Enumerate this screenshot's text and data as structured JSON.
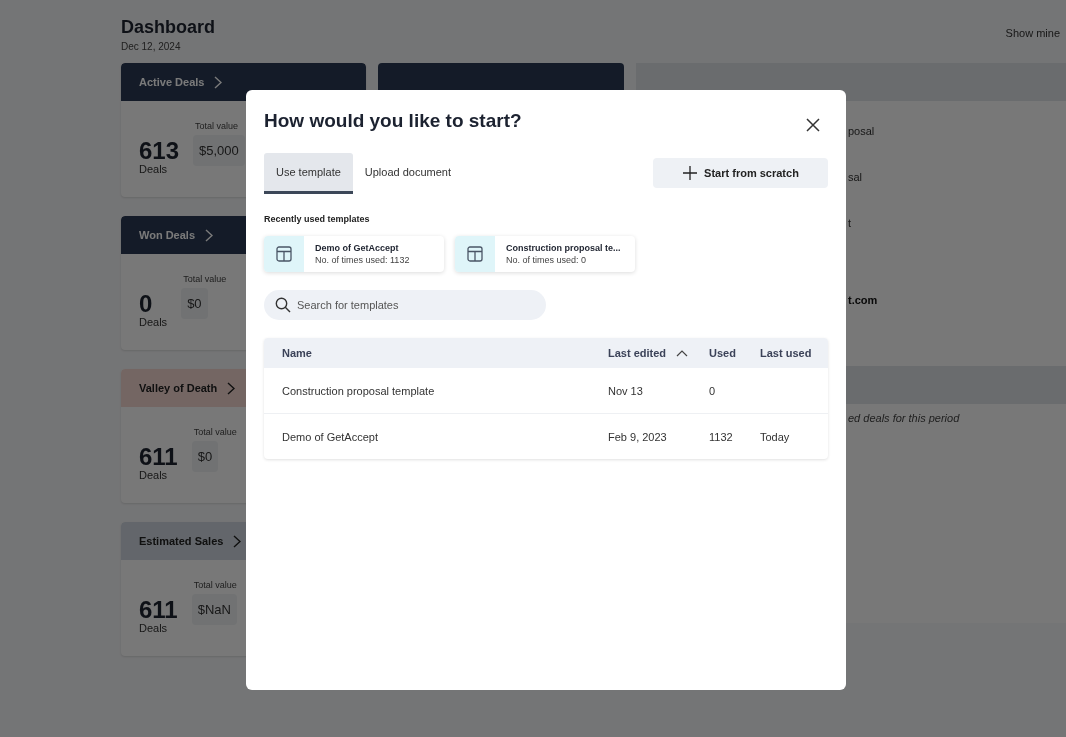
{
  "page": {
    "title": "Dashboard",
    "date": "Dec 12, 2024",
    "show_mine": "Show mine"
  },
  "deal_cards": [
    {
      "title": "Active Deals",
      "kind": "dark",
      "count": "613",
      "count_label": "Deals",
      "total_label": "Total value",
      "total": "$5,000"
    },
    {
      "title": "Won Deals",
      "kind": "dark",
      "count": "0",
      "count_label": "Deals",
      "total_label": "Total value",
      "total": "$0"
    },
    {
      "title": "Valley of Death",
      "kind": "danger",
      "count": "611",
      "count_label": "Deals",
      "total_label": "Total value",
      "total": "$0"
    },
    {
      "title": "Estimated Sales",
      "kind": "muted",
      "count": "611",
      "count_label": "Deals",
      "total_label": "Total value",
      "total": "$NaN"
    }
  ],
  "right_panel": {
    "rows": [
      {
        "text": "posal",
        "bold": false
      },
      {
        "text": "sal",
        "bold": false
      },
      {
        "text": "t",
        "bold": false
      },
      {
        "text": "t.com",
        "bold": true
      }
    ],
    "empty_note": "ed deals for this period"
  },
  "modal": {
    "title": "How would you like to start?",
    "tabs": [
      {
        "label": "Use template",
        "selected": true
      },
      {
        "label": "Upload document",
        "selected": false
      }
    ],
    "start_button": "Start from scratch",
    "recent_heading": "Recently used templates",
    "recent_templates": [
      {
        "name": "Demo of GetAccept",
        "usage": "No. of times used: 1132"
      },
      {
        "name": "Construction proposal te...",
        "usage": "No. of times used: 0"
      }
    ],
    "search": {
      "placeholder": "Search for templates"
    },
    "table": {
      "columns": [
        {
          "label": "Name",
          "sorted": false
        },
        {
          "label": "Last edited",
          "sorted": true
        },
        {
          "label": "Used",
          "sorted": false
        },
        {
          "label": "Last used",
          "sorted": false
        }
      ],
      "rows": [
        [
          "Construction proposal template",
          "Nov 13",
          "0",
          ""
        ],
        [
          "Demo of GetAccept",
          "Feb 9, 2023",
          "1132",
          "Today"
        ]
      ]
    }
  }
}
